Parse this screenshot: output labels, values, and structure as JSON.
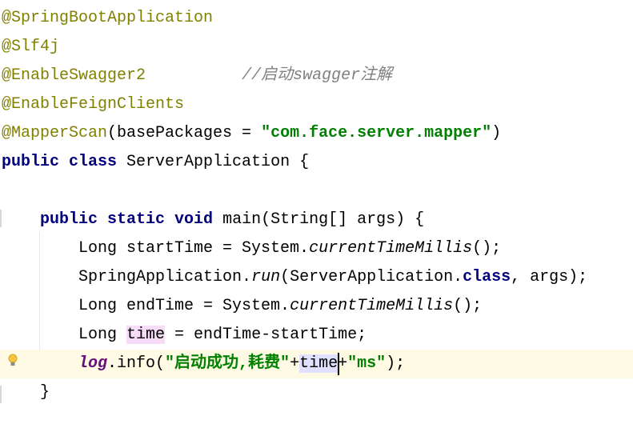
{
  "editor": {
    "caret_line": 12,
    "lines": [
      [
        {
          "t": "@SpringBootApplication",
          "c": "ann"
        }
      ],
      [
        {
          "t": "@Slf4j",
          "c": "ann"
        }
      ],
      [
        {
          "t": "@EnableSwagger2",
          "c": "ann"
        },
        {
          "t": "          "
        },
        {
          "t": "//启动swagger注解",
          "c": "cmt"
        }
      ],
      [
        {
          "t": "@EnableFeignClients",
          "c": "ann"
        }
      ],
      [
        {
          "t": "@MapperScan",
          "c": "ann"
        },
        {
          "t": "(basePackages = "
        },
        {
          "t": "\"com.face.server.mapper\"",
          "c": "str"
        },
        {
          "t": ")"
        }
      ],
      [
        {
          "t": "public class",
          "c": "kw"
        },
        {
          "t": " ServerApplication {"
        }
      ],
      [],
      [
        {
          "t": "    "
        },
        {
          "t": "public static void",
          "c": "kw"
        },
        {
          "t": " main(String[] args) {"
        }
      ],
      [
        {
          "t": "        Long startTime = System."
        },
        {
          "t": "currentTimeMillis",
          "c": "st"
        },
        {
          "t": "();"
        }
      ],
      [
        {
          "t": "        SpringApplication."
        },
        {
          "t": "run",
          "c": "st"
        },
        {
          "t": "(ServerApplication."
        },
        {
          "t": "class",
          "c": "kw"
        },
        {
          "t": ", args);"
        }
      ],
      [
        {
          "t": "        Long endTime = System."
        },
        {
          "t": "currentTimeMillis",
          "c": "st"
        },
        {
          "t": "();"
        }
      ],
      [
        {
          "t": "        Long "
        },
        {
          "t": "time",
          "c": "hl-write"
        },
        {
          "t": " = endTime-startTime;"
        }
      ],
      [
        {
          "t": "        "
        },
        {
          "t": "log",
          "c": "fld"
        },
        {
          "t": ".info("
        },
        {
          "t": "\"启动成功,耗费\"",
          "c": "str"
        },
        {
          "t": "+"
        },
        {
          "t": "time",
          "c": "hl-read"
        },
        {
          "t": "+"
        },
        {
          "t": "\"ms\"",
          "c": "str"
        },
        {
          "t": ");"
        }
      ],
      [
        {
          "t": "    }"
        }
      ]
    ]
  },
  "colors": {
    "annotation": "#808000",
    "keyword": "#000080",
    "string": "#008000",
    "comment": "#808080",
    "field": "#660e7a",
    "current_line": "#fffae3"
  },
  "icons": {
    "gutter": "lightbulb-icon"
  }
}
